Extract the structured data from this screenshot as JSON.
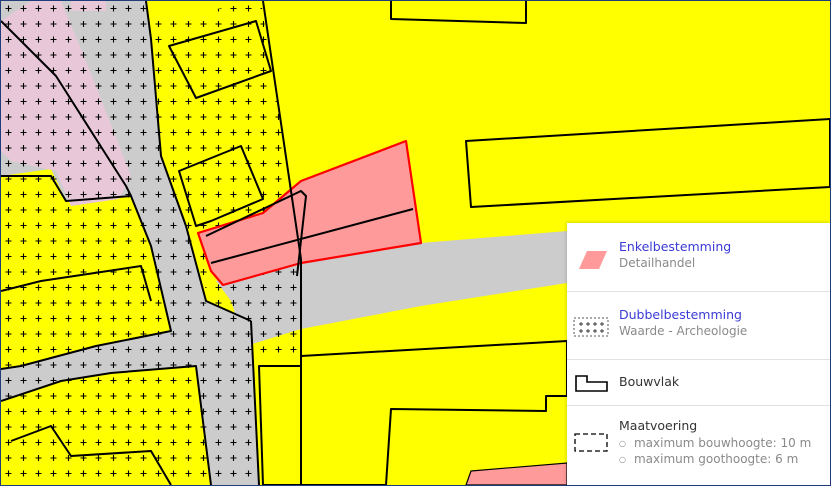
{
  "map": {
    "colors": {
      "woongebied": "#ffff00",
      "verkeer": "#cccccc",
      "detailhandel": "#ff9a9a",
      "gemengd": "#e8c8d8",
      "boundary": "#000000",
      "selection": "#ff0000"
    }
  },
  "legend": {
    "enkelbestemming": {
      "title": "Enkelbestemming",
      "subtitle": "Detailhandel",
      "color": "#ff9a9a",
      "icon": "pink-parallelogram-swatch"
    },
    "dubbelbestemming": {
      "title": "Dubbelbestemming",
      "subtitle": "Waarde - Archeologie",
      "icon": "plus-pattern-swatch"
    },
    "bouwvlak": {
      "label": "Bouwvlak",
      "icon": "building-outline-swatch"
    },
    "maatvoering": {
      "label": "Maatvoering",
      "icon": "dashed-rectangle-swatch",
      "items": [
        "maximum bouwhoogte: 10 m",
        "maximum goothoogte: 6 m"
      ]
    }
  }
}
